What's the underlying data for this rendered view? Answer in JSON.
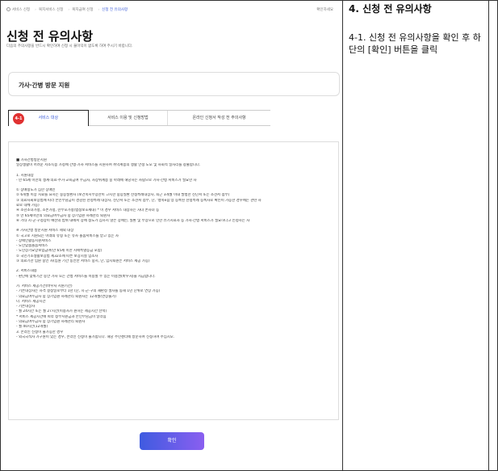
{
  "breadcrumb": {
    "items": [
      "서비스 신청",
      "복지서비스 신청",
      "복지급여 신청"
    ],
    "current": "신청 전 유의사항",
    "right_link": "확인하세요"
  },
  "page": {
    "title": "신청 전 유의사항",
    "subtitle": "다음의 주의사항을 반드시 확인하여 신청 시 불이익이 없도록 하여 주시기 바랍니다."
  },
  "service": {
    "name": "가사·간병 방문 지원"
  },
  "tabs": [
    {
      "label": "서비스 대상",
      "badge": "4-1"
    },
    {
      "label": "서비스 이용 및 신청방법"
    },
    {
      "label": "온라인 신청서 작성 전 주의사항"
    }
  ],
  "notice_lines": [
    "■ 가사간병방문지원",
    "일상생활이 어려운 저소득층 가정에 간병·가사 서비스를 지원하여 취약계층의 생활 안정 도모 및 사회적 일자리를 창출합니다.",
    "",
    "1. 지원대상",
    "- 만 65세 미만의 생계·의료·주거·교육급여 수급자, 차상위계층 중 아래에 해당하는 사람으로 가사·간병 서비스가 필요한 자",
    "",
    "① 장애정도가 심한 장애인",
    "② 6개월 이상 치료를 요하는 중증질환자 (보건복지부장관이 고시한 중증질환 산정특례대상자, 최근 3개월 이내 발병한 진단서 또는 소견서 첨부)",
    "③ 의료사회보장법에 따라 본인부담금이 경감된 산정특례 대상자, 진단서 또는 소견서 첨부, 단, '행복e음'상 등록된 산정특례 등록자로 확인이 가능한 경우에는 관련 자",
    "료로 대체 가능)",
    "④ 소년소녀가정, 조손가정, 한부모가정(법정보호세대) * 이 경우 서비스 대상자는 자녀 손자녀 등",
    "⑤ 만 65세미만의 의료급여수급자 중 장기입원 사례관리 퇴원자",
    "⑥ 기타 시·군·구청장이 예산의 범위 내에서 장애 정도가 심하지 않은 장애인, 질환 및 부상으로 인한 유기치료자 등 가사·간병 서비스가 필요하다고 인정하는 자",
    "",
    "※ 가사간병 방문지원 서비스 제외 대상",
    "① 국고로 지원되는 아래의 유형 또는 유사 돌봄서비스를 받고 있는 자",
    "- 장애인활동지원서비스",
    "- 노인맞춤돌봄서비스",
    "- 노인장기요양보험급여(만 65세 미만 치매특별등급 포함)",
    "② 국민기초생활보장법 제32조에 따른 보장시설 입소자",
    "③ 의료기관 입원 중인 자(입원 기간 동안만 서비스 중지, 단, 임시퇴원은 서비스 제공 가능)",
    "",
    "2. 서비스내용",
    "- 판단에 맞춰기간 동안 가사 또는 간병 서비스를 이용할 수 있는 이용권(바우처)을 지급합니다.",
    "",
    "가. 서비스 제공기간(바우처 지원기간)",
    "- 기존대상자는 자격 결정일로부터 1년 (단, 시·군·구의 재판정 절차를 통해 1년 단위로 연장 가능)",
    "- 의료급여수급자 중 장기입원 사례관리 퇴원자는 12개월(연장불가)",
    "나. 서비스 제공시간",
    "- 기존대상자",
    "- 월 24시간 또는 월 27시간(이용자가 원하는 제공시간 선택)",
    "* 서비스 제공시간에 따라 정부지원금과 본인부담금이 달라짐",
    "- 의료급여수급자 중 장기입원 사례관리 퇴원자",
    "- 월 40시간(12개월)",
    "3. 온라인 신청이 불가능한 경우",
    "- 외국국적자 가구원이 있는 경우, 온라인 신청이 불가합니다. 해당 주민센터에 방문하여 신청하여 주십시오."
  ],
  "confirm_button": "확인",
  "guide": {
    "title": "4. 신청 전 유의사항",
    "description": "4-1. 신청 전 유의사항을 확인 후 하단의 [확인] 버튼을 클릭"
  }
}
